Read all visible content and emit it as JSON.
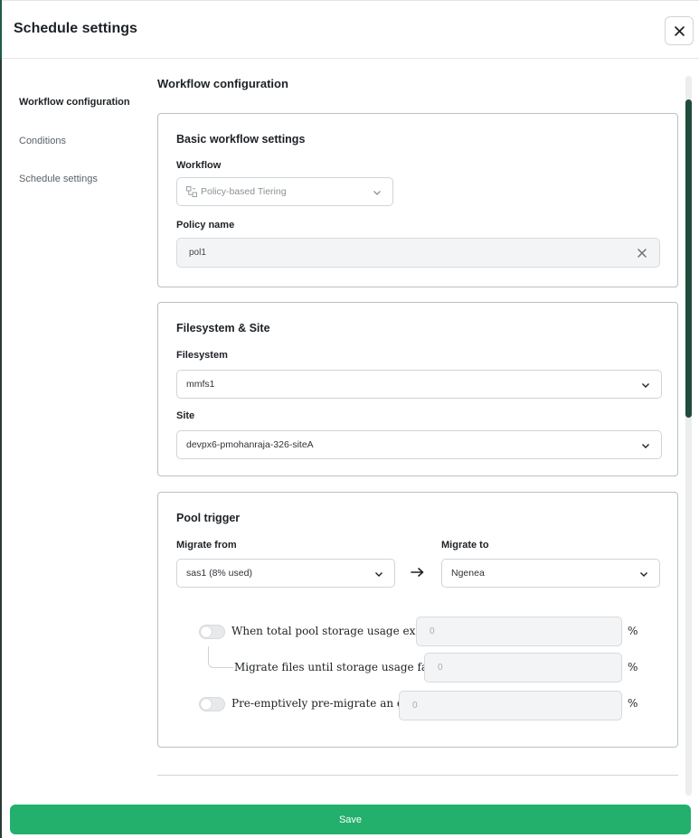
{
  "header": {
    "title": "Schedule settings"
  },
  "sidebar": {
    "items": [
      {
        "label": "Workflow configuration",
        "active": true
      },
      {
        "label": "Conditions",
        "active": false
      },
      {
        "label": "Schedule settings",
        "active": false
      }
    ]
  },
  "main": {
    "title": "Workflow configuration",
    "basic": {
      "title": "Basic workflow settings",
      "workflow_label": "Workflow",
      "workflow_value": "Policy-based Tiering",
      "policy_label": "Policy name",
      "policy_value": "pol1"
    },
    "filesystem": {
      "title": "Filesystem & Site",
      "filesystem_label": "Filesystem",
      "filesystem_value": "mmfs1",
      "site_label": "Site",
      "site_value": "devpx6-pmohanraja-326-siteA"
    },
    "pool": {
      "title": "Pool trigger",
      "from_label": "Migrate from",
      "from_value": "sas1 (8% used)",
      "to_label": "Migrate to",
      "to_value": "Ngenea",
      "exceeds_label": "When total pool storage usage exceeds",
      "exceeds_placeholder": "0",
      "until_label": "Migrate files until storage usage falls to",
      "until_placeholder": "0",
      "premigrate_label": "Pre-emptively pre-migrate an extra",
      "premigrate_placeholder": "0",
      "percent": "%",
      "exceeds_enabled": false,
      "premigrate_enabled": false
    }
  },
  "footer": {
    "save_label": "Save"
  },
  "colors": {
    "primary": "#22b06c",
    "scrollbar": "#1f4c3b",
    "border": "#b9c0c5"
  },
  "icons": {
    "close": "close-icon",
    "chevron": "chevron-down-icon",
    "clear": "clear-icon",
    "arrow": "arrow-right-icon",
    "workflow": "workflow-icon"
  }
}
